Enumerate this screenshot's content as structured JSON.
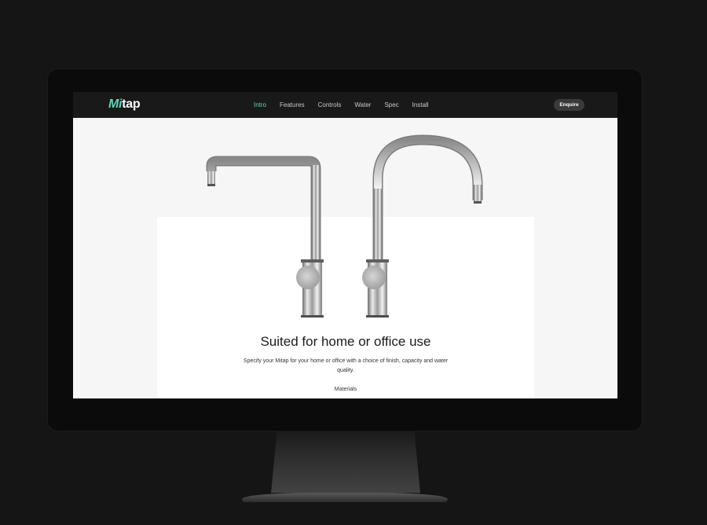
{
  "header": {
    "logo_prefix": "Mi",
    "logo_suffix": "tap",
    "nav": [
      {
        "label": "Intro",
        "active": true
      },
      {
        "label": "Features",
        "active": false
      },
      {
        "label": "Controls",
        "active": false
      },
      {
        "label": "Water",
        "active": false
      },
      {
        "label": "Spec",
        "active": false
      },
      {
        "label": "Install",
        "active": false
      }
    ],
    "cta_label": "Enquire"
  },
  "hero": {
    "image_description_icon": "tap-product-image"
  },
  "content": {
    "heading": "Suited for home or office use",
    "body": "Specify your Mitap for your home or office with a choice of finish, capacity and water quality.",
    "materials_label": "Materials"
  },
  "colors": {
    "accent": "#5fd6b6",
    "nav_bg": "#191919",
    "page_bg": "#f6f6f6",
    "device_bg": "#151515"
  }
}
